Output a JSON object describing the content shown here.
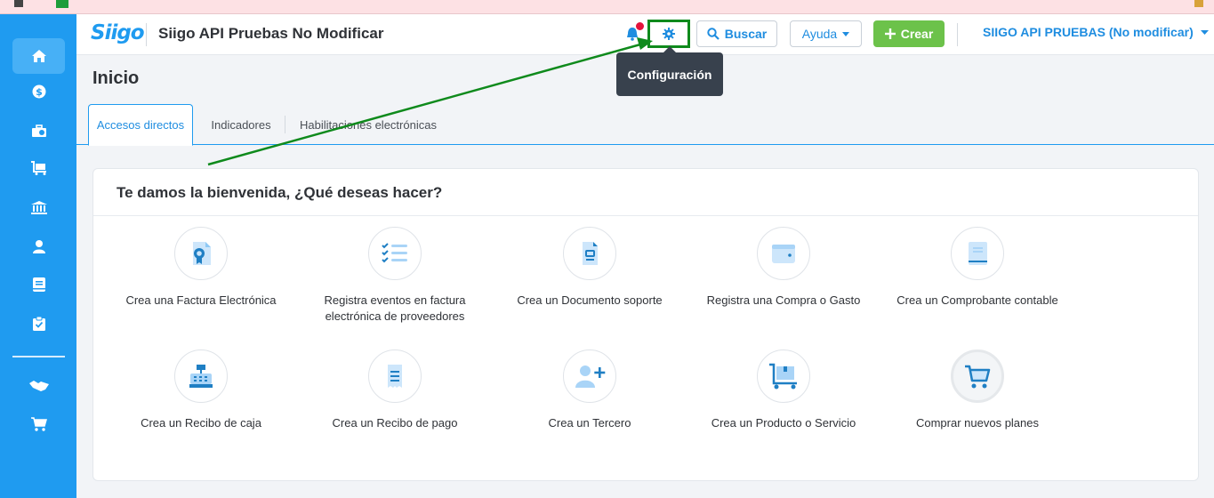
{
  "app": {
    "logo": "Siigo",
    "company_name": "Siigo API Pruebas No Modificar",
    "user_menu": "SIIGO API PRUEBAS (No modificar)"
  },
  "header": {
    "search_label": "Buscar",
    "help_label": "Ayuda",
    "create_label": "Crear",
    "settings_tooltip": "Configuración",
    "bell_icon": "bell-icon",
    "settings_icon": "gear-icon"
  },
  "page": {
    "title": "Inicio",
    "tabs": [
      {
        "label": "Accesos directos",
        "active": true
      },
      {
        "label": "Indicadores",
        "active": false
      },
      {
        "label": "Habilitaciones electrónicas",
        "active": false
      }
    ]
  },
  "welcome": {
    "title": "Te damos la bienvenida, ¿Qué deseas hacer?",
    "actions": [
      {
        "label": "Crea una Factura Electrónica",
        "icon": "invoice-ribbon-icon"
      },
      {
        "label": "Registra eventos en factura electrónica de proveedores",
        "icon": "checklist-icon"
      },
      {
        "label": "Crea un Documento soporte",
        "icon": "document-icon"
      },
      {
        "label": "Registra una Compra o Gasto",
        "icon": "wallet-icon"
      },
      {
        "label": "Crea un Comprobante contable",
        "icon": "ledger-book-icon"
      },
      {
        "label": "Crea un Recibo de caja",
        "icon": "cash-register-icon"
      },
      {
        "label": "Crea un Recibo de pago",
        "icon": "receipt-icon"
      },
      {
        "label": "Crea un Tercero",
        "icon": "add-user-icon"
      },
      {
        "label": "Crea un Producto o Servicio",
        "icon": "cart-box-icon"
      },
      {
        "label": "Comprar nuevos planes",
        "icon": "shopping-cart-icon"
      }
    ]
  },
  "colors": {
    "brand_blue": "#1f9bf0",
    "create_green": "#6cc24a",
    "highlight_green": "#0f8a1c",
    "notification_red": "#e4133c"
  }
}
